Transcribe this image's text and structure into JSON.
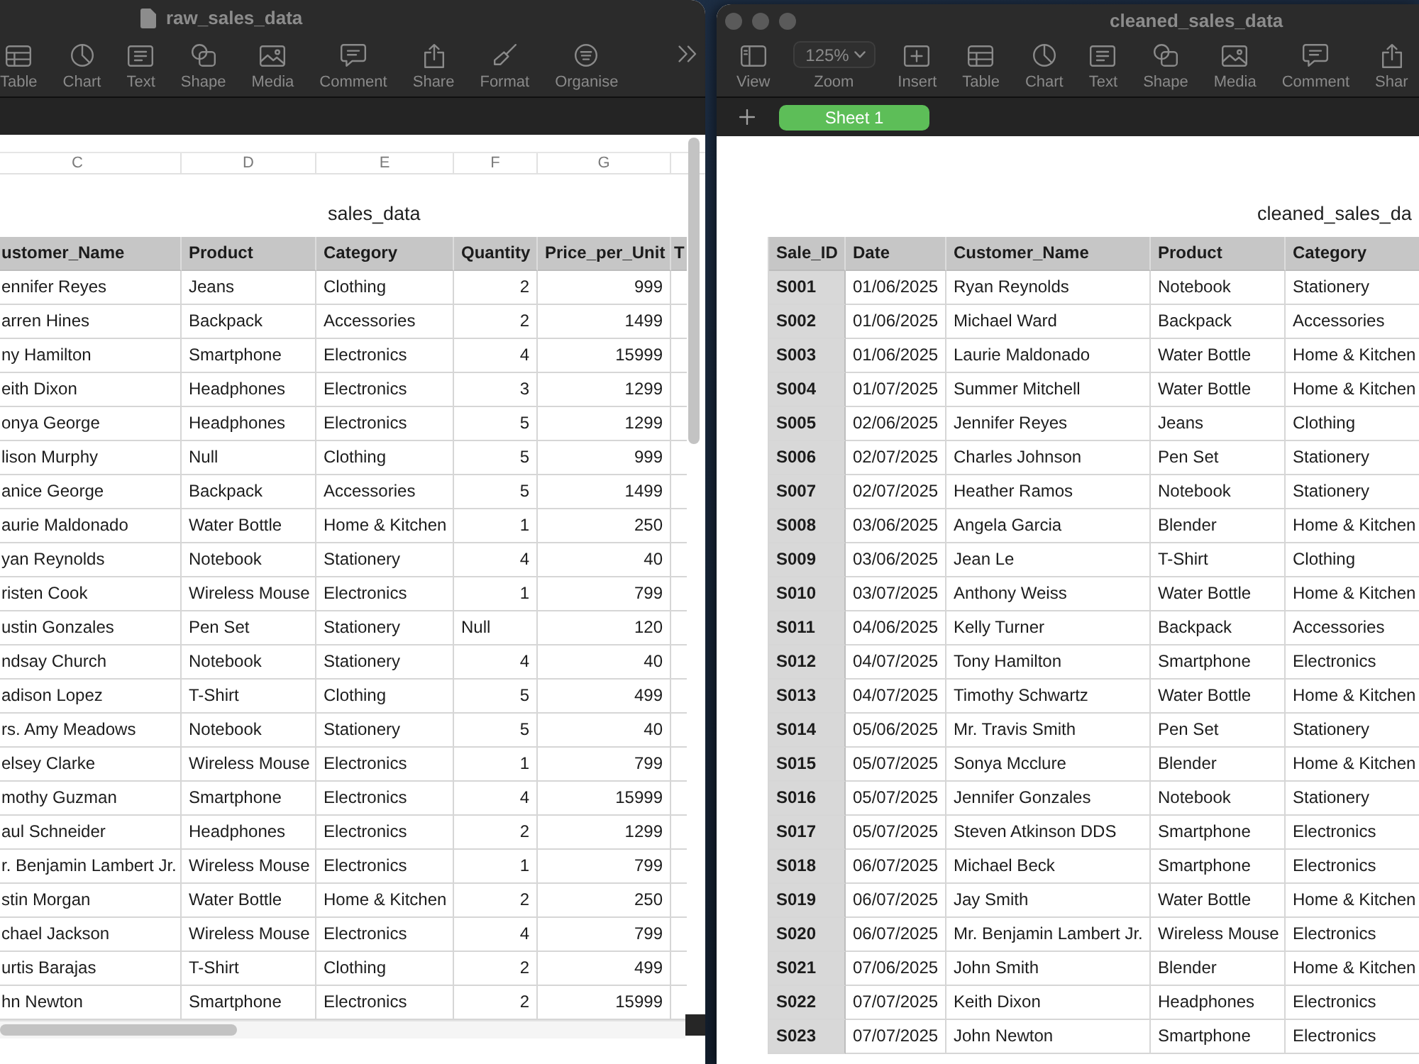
{
  "raw_window": {
    "title": "raw_sales_data",
    "toolbar": [
      {
        "label": "Table",
        "kind": "button"
      },
      {
        "label": "Chart",
        "kind": "button"
      },
      {
        "label": "Text",
        "kind": "button"
      },
      {
        "label": "Shape",
        "kind": "button"
      },
      {
        "label": "Media",
        "kind": "button"
      },
      {
        "label": "Comment",
        "kind": "button"
      },
      {
        "label": "Share",
        "kind": "button"
      },
      {
        "label": "Format",
        "kind": "button"
      },
      {
        "label": "Organise",
        "kind": "button"
      }
    ],
    "column_letters": [
      "C",
      "D",
      "E",
      "F",
      "G"
    ],
    "table": {
      "title": "sales_data",
      "columns": [
        "ustomer_Name",
        "Product",
        "Category",
        "Quantity",
        "Price_per_Unit",
        "T"
      ],
      "rows": [
        [
          "ennifer Reyes",
          "Jeans",
          "Clothing",
          "2",
          "999"
        ],
        [
          "arren Hines",
          "Backpack",
          "Accessories",
          "2",
          "1499"
        ],
        [
          "ny Hamilton",
          "Smartphone",
          "Electronics",
          "4",
          "15999"
        ],
        [
          "eith Dixon",
          "Headphones",
          "Electronics",
          "3",
          "1299"
        ],
        [
          "onya George",
          "Headphones",
          "Electronics",
          "5",
          "1299"
        ],
        [
          "lison Murphy",
          "Null",
          "Clothing",
          "5",
          "999"
        ],
        [
          "anice George",
          "Backpack",
          "Accessories",
          "5",
          "1499"
        ],
        [
          "aurie Maldonado",
          "Water Bottle",
          "Home & Kitchen",
          "1",
          "250"
        ],
        [
          "yan Reynolds",
          "Notebook",
          "Stationery",
          "4",
          "40"
        ],
        [
          "risten Cook",
          "Wireless Mouse",
          "Electronics",
          "1",
          "799"
        ],
        [
          "ustin Gonzales",
          "Pen Set",
          "Stationery",
          "Null",
          "120"
        ],
        [
          "ndsay Church",
          "Notebook",
          "Stationery",
          "4",
          "40"
        ],
        [
          "adison Lopez",
          "T-Shirt",
          "Clothing",
          "5",
          "499"
        ],
        [
          "rs. Amy Meadows",
          "Notebook",
          "Stationery",
          "5",
          "40"
        ],
        [
          "elsey Clarke",
          "Wireless Mouse",
          "Electronics",
          "1",
          "799"
        ],
        [
          "mothy Guzman",
          "Smartphone",
          "Electronics",
          "4",
          "15999"
        ],
        [
          "aul Schneider",
          "Headphones",
          "Electronics",
          "2",
          "1299"
        ],
        [
          "r. Benjamin Lambert Jr.",
          "Wireless Mouse",
          "Electronics",
          "1",
          "799"
        ],
        [
          "stin Morgan",
          "Water Bottle",
          "Home & Kitchen",
          "2",
          "250"
        ],
        [
          "chael Jackson",
          "Wireless Mouse",
          "Electronics",
          "4",
          "799"
        ],
        [
          "urtis Barajas",
          "T-Shirt",
          "Clothing",
          "2",
          "499"
        ],
        [
          "hn Newton",
          "Smartphone",
          "Electronics",
          "2",
          "15999"
        ]
      ]
    }
  },
  "cleaned_window": {
    "title": "cleaned_sales_data",
    "toolbar": [
      {
        "label": "View",
        "kind": "button"
      },
      {
        "label": "Zoom",
        "kind": "dropdown",
        "value": "125%"
      },
      {
        "label": "Insert",
        "kind": "button"
      },
      {
        "label": "Table",
        "kind": "button"
      },
      {
        "label": "Chart",
        "kind": "button"
      },
      {
        "label": "Text",
        "kind": "button"
      },
      {
        "label": "Shape",
        "kind": "button"
      },
      {
        "label": "Media",
        "kind": "button"
      },
      {
        "label": "Comment",
        "kind": "button"
      },
      {
        "label": "Shar",
        "kind": "button"
      }
    ],
    "tabs": [
      {
        "label": "Sheet 1",
        "selected": true
      }
    ],
    "table": {
      "title": "cleaned_sales_da",
      "header_column": true,
      "columns": [
        "Sale_ID",
        "Date",
        "Customer_Name",
        "Product",
        "Category"
      ],
      "rows": [
        [
          "S001",
          "01/06/2025",
          "Ryan Reynolds",
          "Notebook",
          "Stationery"
        ],
        [
          "S002",
          "01/06/2025",
          "Michael Ward",
          "Backpack",
          "Accessories"
        ],
        [
          "S003",
          "01/06/2025",
          "Laurie Maldonado",
          "Water Bottle",
          "Home & Kitchen"
        ],
        [
          "S004",
          "01/07/2025",
          "Summer Mitchell",
          "Water Bottle",
          "Home & Kitchen"
        ],
        [
          "S005",
          "02/06/2025",
          "Jennifer Reyes",
          "Jeans",
          "Clothing"
        ],
        [
          "S006",
          "02/07/2025",
          "Charles Johnson",
          "Pen Set",
          "Stationery"
        ],
        [
          "S007",
          "02/07/2025",
          "Heather Ramos",
          "Notebook",
          "Stationery"
        ],
        [
          "S008",
          "03/06/2025",
          "Angela Garcia",
          "Blender",
          "Home & Kitchen"
        ],
        [
          "S009",
          "03/06/2025",
          "Jean Le",
          "T-Shirt",
          "Clothing"
        ],
        [
          "S010",
          "03/07/2025",
          "Anthony Weiss",
          "Water Bottle",
          "Home & Kitchen"
        ],
        [
          "S011",
          "04/06/2025",
          "Kelly Turner",
          "Backpack",
          "Accessories"
        ],
        [
          "S012",
          "04/07/2025",
          "Tony Hamilton",
          "Smartphone",
          "Electronics"
        ],
        [
          "S013",
          "04/07/2025",
          "Timothy Schwartz",
          "Water Bottle",
          "Home & Kitchen"
        ],
        [
          "S014",
          "05/06/2025",
          "Mr. Travis Smith",
          "Pen Set",
          "Stationery"
        ],
        [
          "S015",
          "05/07/2025",
          "Sonya Mcclure",
          "Blender",
          "Home & Kitchen"
        ],
        [
          "S016",
          "05/07/2025",
          "Jennifer Gonzales",
          "Notebook",
          "Stationery"
        ],
        [
          "S017",
          "05/07/2025",
          "Steven Atkinson DDS",
          "Smartphone",
          "Electronics"
        ],
        [
          "S018",
          "06/07/2025",
          "Michael Beck",
          "Smartphone",
          "Electronics"
        ],
        [
          "S019",
          "06/07/2025",
          "Jay Smith",
          "Water Bottle",
          "Home & Kitchen"
        ],
        [
          "S020",
          "06/07/2025",
          "Mr. Benjamin Lambert Jr.",
          "Wireless Mouse",
          "Electronics"
        ],
        [
          "S021",
          "07/06/2025",
          "John Smith",
          "Blender",
          "Home & Kitchen"
        ],
        [
          "S022",
          "07/07/2025",
          "Keith Dixon",
          "Headphones",
          "Electronics"
        ],
        [
          "S023",
          "07/07/2025",
          "John Newton",
          "Smartphone",
          "Electronics"
        ]
      ]
    }
  }
}
